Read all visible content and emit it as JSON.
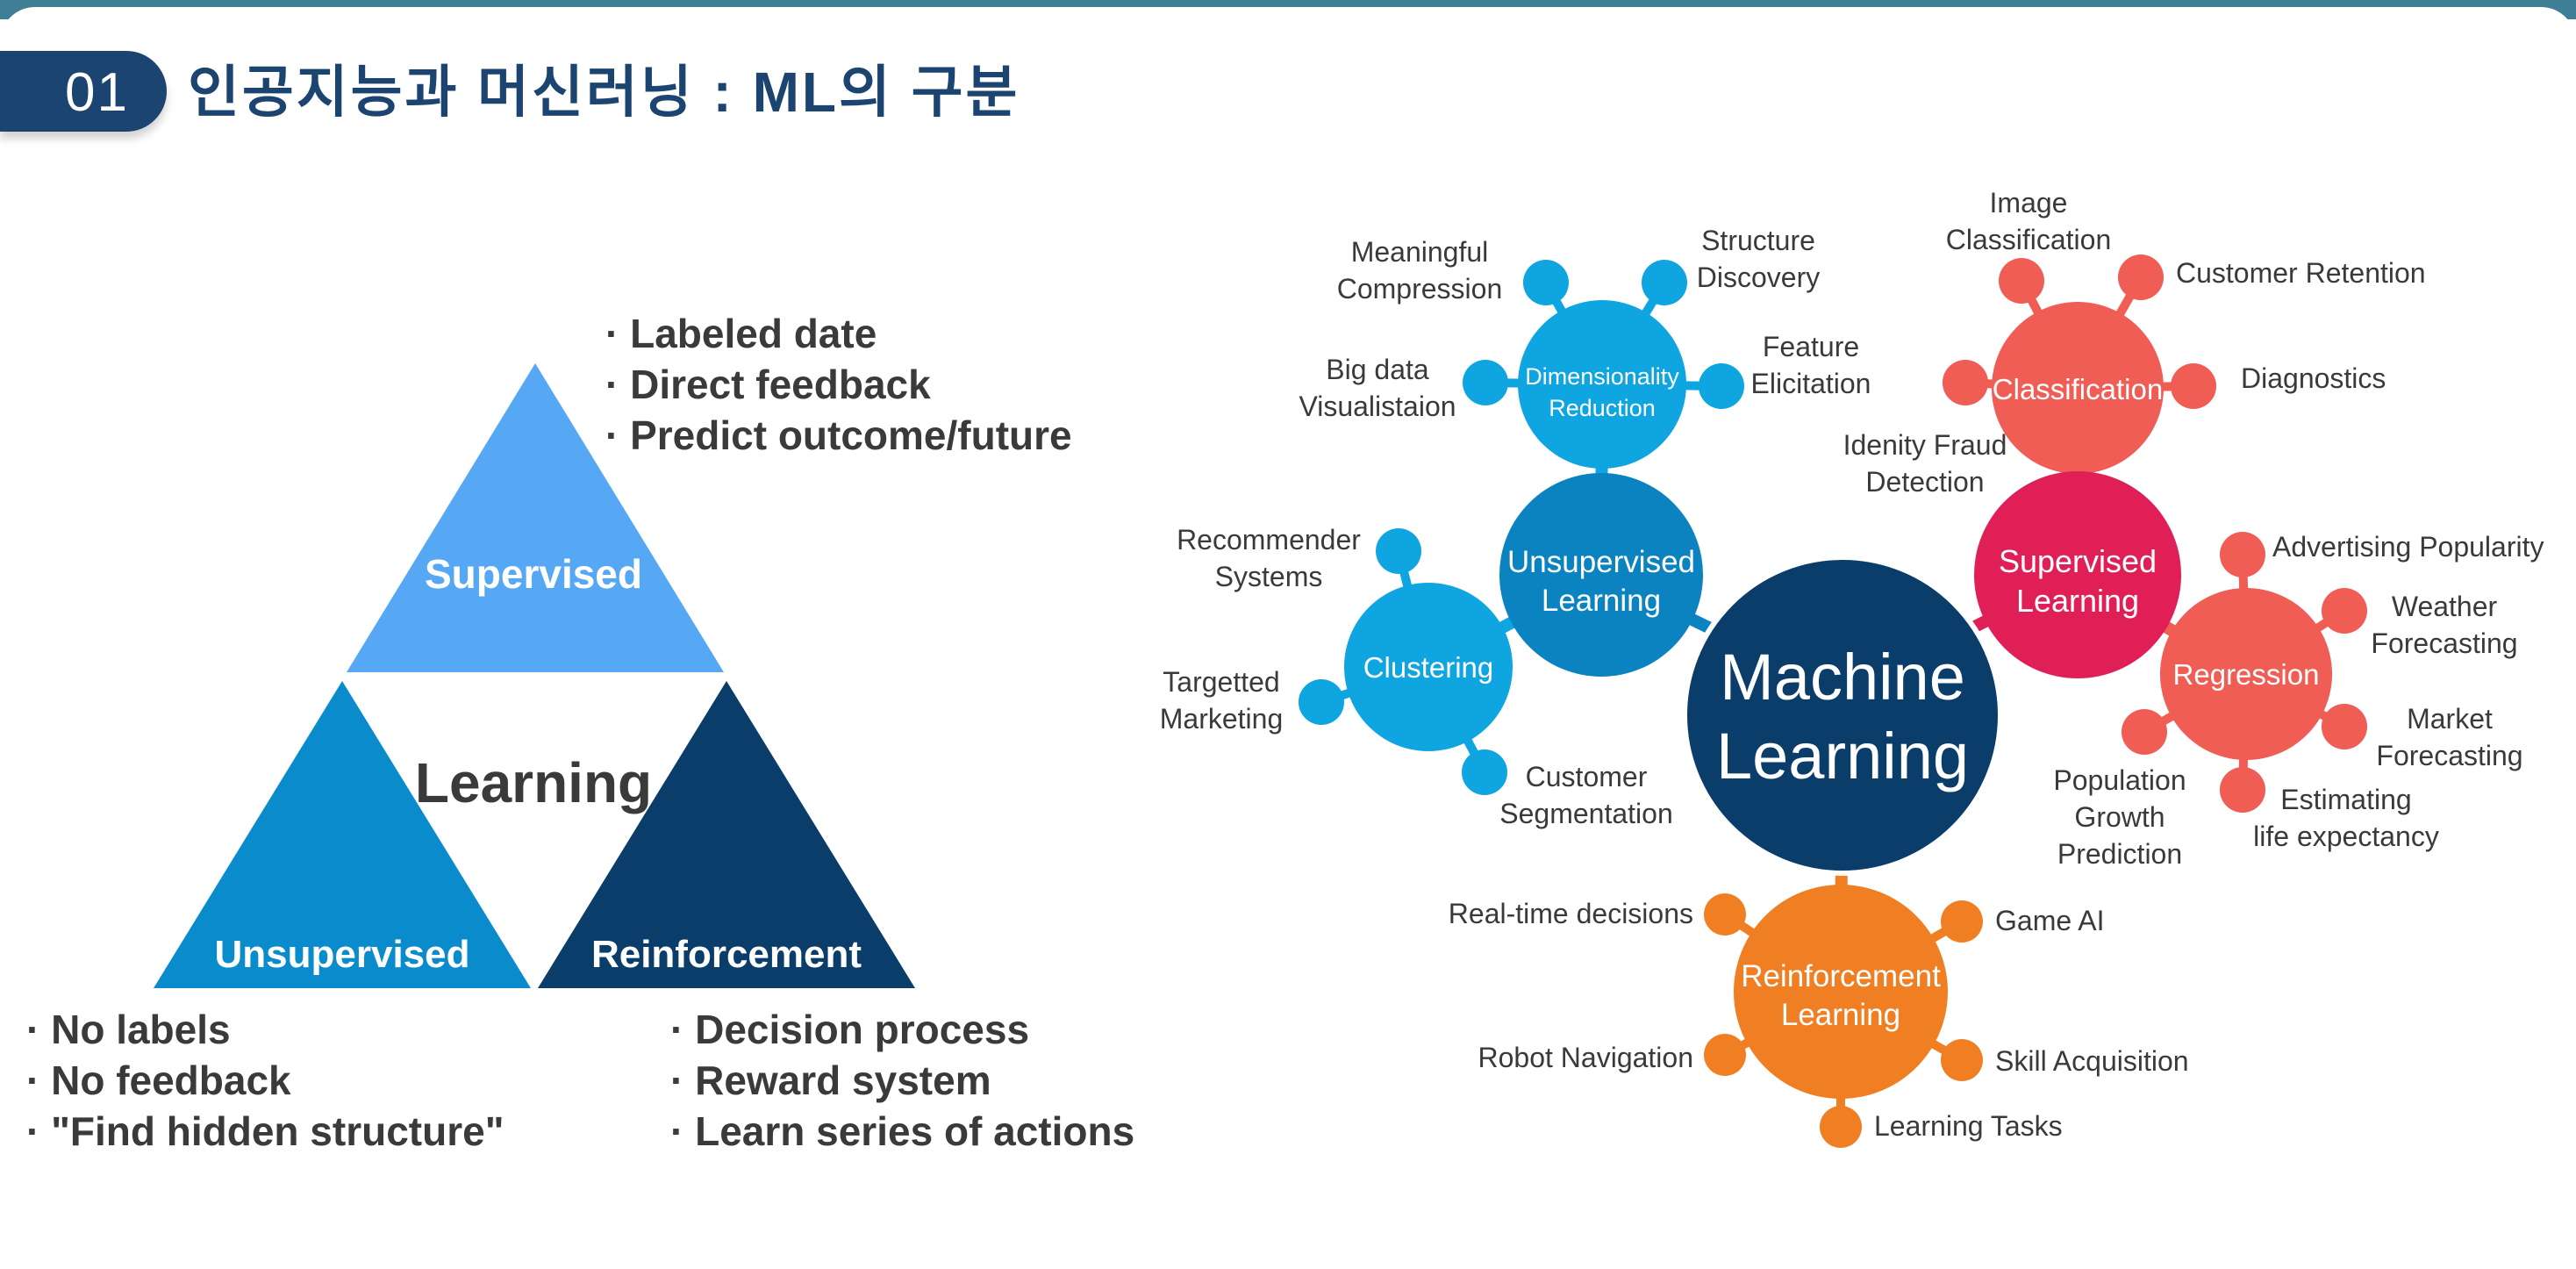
{
  "header": {
    "number": "01",
    "title": "인공지능과 머신러닝 : ML의 구분"
  },
  "triangle": {
    "center_label": "Learning",
    "supervised": {
      "label": "Supervised",
      "color": "#56a8f4",
      "bullets": [
        "· Labeled date",
        "· Direct feedback",
        "· Predict outcome/future"
      ]
    },
    "unsupervised": {
      "label": "Unsupervised",
      "color": "#0a8ccc",
      "bullets": [
        "· No labels",
        "· No feedback",
        "· \"Find hidden structure\""
      ]
    },
    "reinforcement": {
      "label": "Reinforcement",
      "color": "#0b3d6b",
      "bullets": [
        "· Decision process",
        "· Reward system",
        "· Learn series of actions"
      ]
    }
  },
  "mindmap": {
    "center": {
      "lines": [
        "Machine",
        "Learning"
      ],
      "color": "#0b3d6b"
    },
    "colors": {
      "cyan": "#0ea5e0",
      "blue": "#0a83c0",
      "crimson": "#e11f57",
      "coral": "#ef5d55",
      "orange": "#f07f23"
    },
    "unsupervised_learning": {
      "lines": [
        "Unsupervised",
        "Learning"
      ]
    },
    "dimensionality_reduction": {
      "lines": [
        "Dimensionality",
        "Reduction"
      ],
      "leaves": {
        "meaningful_compression": [
          "Meaningful",
          "Compression"
        ],
        "structure_discovery": [
          "Structure",
          "Discovery"
        ],
        "big_data_visualisation": [
          "Big data",
          "Visualistaion"
        ],
        "feature_elicitation": [
          "Feature",
          "Elicitation"
        ]
      }
    },
    "clustering": {
      "label": "Clustering",
      "leaves": {
        "recommender_systems": [
          "Recommender",
          "Systems"
        ],
        "targetted_marketing": [
          "Targetted",
          "Marketing"
        ],
        "customer_segmentation": [
          "Customer",
          "Segmentation"
        ]
      }
    },
    "supervised_learning": {
      "lines": [
        "Supervised",
        "Learning"
      ]
    },
    "classification": {
      "label": "Classification",
      "leaves": {
        "image_classification": [
          "Image",
          "Classification"
        ],
        "customer_retention": [
          "Customer Retention"
        ],
        "diagnostics": [
          "Diagnostics"
        ],
        "identity_fraud_detection": [
          "Idenity Fraud",
          "Detection"
        ]
      }
    },
    "regression": {
      "label": "Regression",
      "leaves": {
        "advertising_popularity": [
          "Advertising Popularity"
        ],
        "weather_forecasting": [
          "Weather",
          "Forecasting"
        ],
        "market_forecasting": [
          "Market",
          "Forecasting"
        ],
        "estimating_life_expectancy": [
          "Estimating",
          "life expectancy"
        ],
        "population_growth_prediction": [
          "Population",
          "Growth",
          "Prediction"
        ]
      }
    },
    "reinforcement_learning": {
      "lines": [
        "Reinforcement",
        "Learning"
      ],
      "leaves": {
        "real_time_decisions": [
          "Real-time decisions"
        ],
        "game_ai": [
          "Game AI"
        ],
        "robot_navigation": [
          "Robot Navigation"
        ],
        "skill_acquisition": [
          "Skill Acquisition"
        ],
        "learning_tasks": [
          "Learning Tasks"
        ]
      }
    }
  }
}
